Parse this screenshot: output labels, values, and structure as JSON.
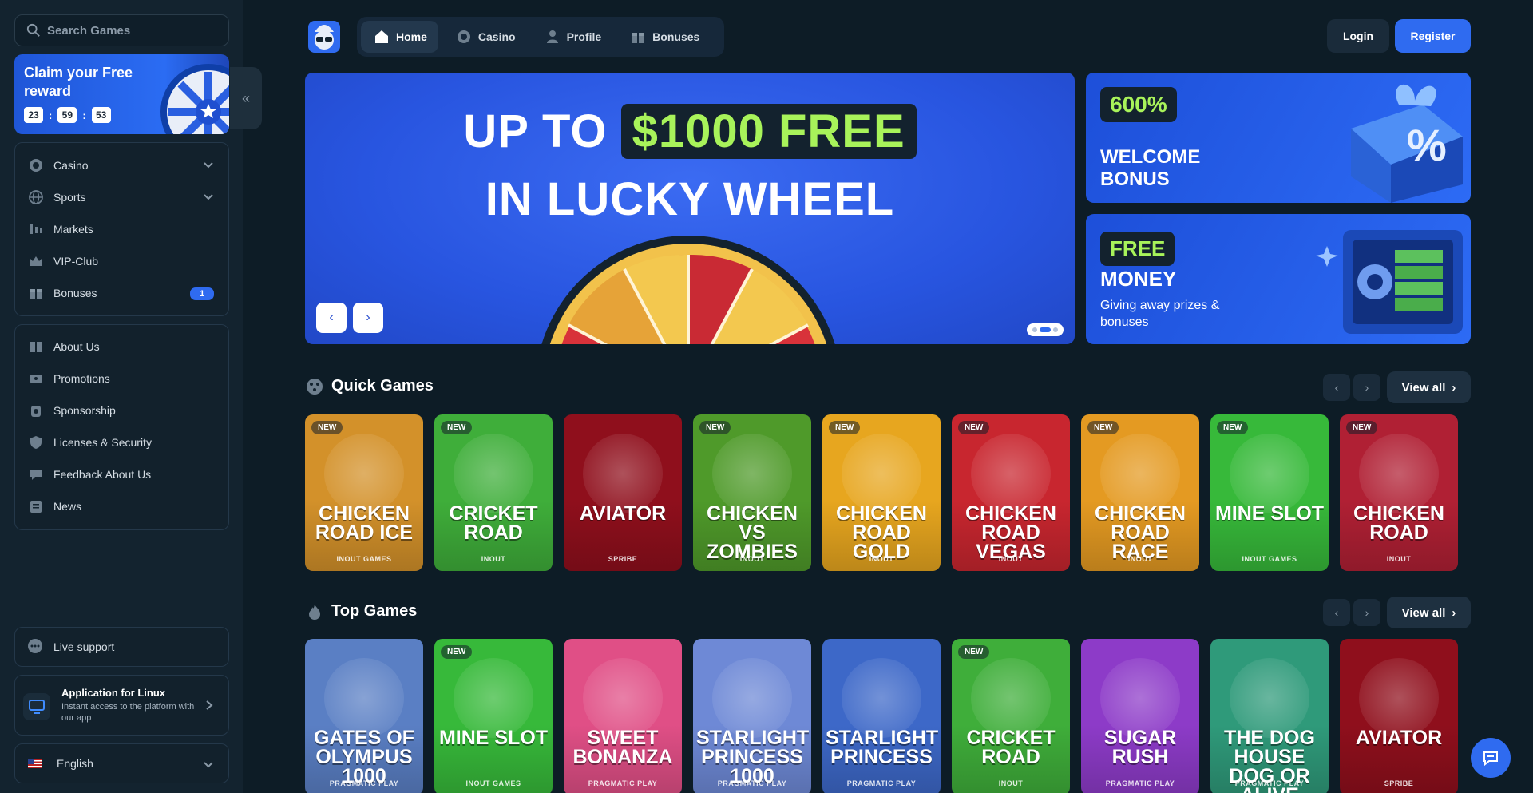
{
  "sidebar": {
    "search_placeholder": "Search Games",
    "reward": {
      "title": "Claim your Free reward",
      "timer": {
        "hours": "23",
        "minutes": "59",
        "seconds": "53"
      }
    },
    "main_nav": [
      {
        "label": "Casino",
        "icon": "casino-chip-icon",
        "has_chevron": true
      },
      {
        "label": "Sports",
        "icon": "globe-icon",
        "has_chevron": true
      },
      {
        "label": "Markets",
        "icon": "markets-icon"
      },
      {
        "label": "VIP-Club",
        "icon": "crown-icon"
      },
      {
        "label": "Bonuses",
        "icon": "gift-icon",
        "badge": "1"
      }
    ],
    "info_nav": [
      {
        "label": "About Us",
        "icon": "book-icon"
      },
      {
        "label": "Promotions",
        "icon": "ticket-icon"
      },
      {
        "label": "Sponsorship",
        "icon": "sponsor-icon"
      },
      {
        "label": "Licenses & Security",
        "icon": "shield-icon"
      },
      {
        "label": "Feedback About Us",
        "icon": "feedback-icon"
      },
      {
        "label": "News",
        "icon": "news-icon"
      }
    ],
    "support_label": "Live support",
    "app": {
      "title": "Application for Linux",
      "subtitle": "Instant access to the platform with our app"
    },
    "language": "English"
  },
  "header": {
    "tabs": [
      {
        "label": "Home",
        "icon": "home-icon",
        "active": true
      },
      {
        "label": "Casino",
        "icon": "casino-chip-icon"
      },
      {
        "label": "Profile",
        "icon": "user-icon"
      },
      {
        "label": "Bonuses",
        "icon": "gift-icon"
      }
    ],
    "login_label": "Login",
    "register_label": "Register"
  },
  "hero": {
    "line1_prefix": "UP TO",
    "line1_highlight": "$1000 FREE",
    "line2": "IN LUCKY WHEEL"
  },
  "promos": [
    {
      "tag": "600%",
      "title": "WELCOME BONUS"
    },
    {
      "tag": "FREE",
      "title": "MONEY",
      "subtitle": "Giving away prizes & bonuses"
    }
  ],
  "quick_games": {
    "title": "Quick Games",
    "view_all": "View all",
    "items": [
      {
        "name": "CHICKEN ROAD ICE",
        "provider": "INOUT GAMES",
        "new": true,
        "color": "#d3912a"
      },
      {
        "name": "CRICKET ROAD",
        "provider": "INOUT",
        "new": true,
        "color": "#3fae3a"
      },
      {
        "name": "AVIATOR",
        "provider": "SPRIBE",
        "new": false,
        "color": "#8f0f1c"
      },
      {
        "name": "CHICKEN VS ZOMBIES",
        "provider": "INOUT",
        "new": true,
        "color": "#4f9a2a"
      },
      {
        "name": "CHICKEN ROAD GOLD",
        "provider": "INOUT",
        "new": true,
        "color": "#e7a61f"
      },
      {
        "name": "CHICKEN ROAD VEGAS",
        "provider": "INOUT",
        "new": true,
        "color": "#c8262f"
      },
      {
        "name": "CHICKEN ROAD RACE",
        "provider": "INOUT",
        "new": true,
        "color": "#e49a22"
      },
      {
        "name": "MINE SLOT",
        "provider": "INOUT GAMES",
        "new": true,
        "color": "#37b93a"
      },
      {
        "name": "CHICKEN ROAD",
        "provider": "INOUT",
        "new": true,
        "color": "#b02034"
      }
    ]
  },
  "top_games": {
    "title": "Top Games",
    "view_all": "View all",
    "items": [
      {
        "name": "GATES OF OLYMPUS 1000",
        "provider": "PRAGMATIC PLAY",
        "new": false,
        "color": "#5a7fc4"
      },
      {
        "name": "MINE SLOT",
        "provider": "INOUT GAMES",
        "new": true,
        "color": "#37b93a"
      },
      {
        "name": "SWEET BONANZA",
        "provider": "PRAGMATIC PLAY",
        "new": false,
        "color": "#e04f86"
      },
      {
        "name": "STARLIGHT PRINCESS 1000",
        "provider": "PRAGMATIC PLAY",
        "new": false,
        "color": "#6e89d6"
      },
      {
        "name": "STARLIGHT PRINCESS",
        "provider": "PRAGMATIC PLAY",
        "new": false,
        "color": "#3d68c8"
      },
      {
        "name": "CRICKET ROAD",
        "provider": "INOUT",
        "new": true,
        "color": "#3fae3a"
      },
      {
        "name": "SUGAR RUSH",
        "provider": "PRAGMATIC PLAY",
        "new": false,
        "color": "#8d3bc8"
      },
      {
        "name": "THE DOG HOUSE DOG OR ALIVE",
        "provider": "PRAGMATIC PLAY",
        "new": false,
        "color": "#2f9a7a"
      },
      {
        "name": "AVIATOR",
        "provider": "SPRIBE",
        "new": false,
        "color": "#8f0f1c"
      }
    ]
  }
}
